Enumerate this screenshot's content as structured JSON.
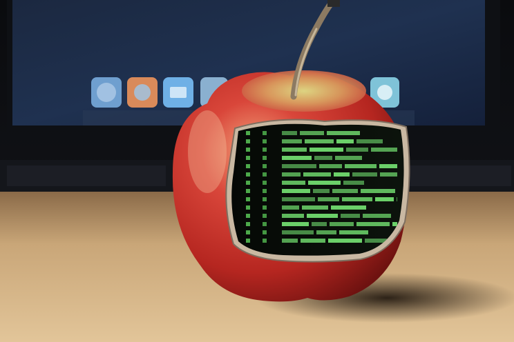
{
  "scene": {
    "description_free": true,
    "colors": {
      "desk_light": "#d8b88c",
      "desk_dark": "#8a6a48",
      "monitor_screen": "#16233a",
      "apple_red": "#c8302a",
      "apple_highlight": "#f0b48a",
      "code_green": "#7cf27a",
      "code_bg": "#0a0f0a"
    },
    "dock_icons": [
      {
        "name": "safari-icon",
        "color": "#6f9fcf"
      },
      {
        "name": "photos-icon",
        "color": "#d98a5a"
      },
      {
        "name": "mail-icon",
        "color": "#6fb0e6"
      },
      {
        "name": "app-icon",
        "color": "#8ab0d0"
      },
      {
        "name": "app-icon-right",
        "color": "#7fc3d8"
      }
    ],
    "code_lines": 14
  }
}
